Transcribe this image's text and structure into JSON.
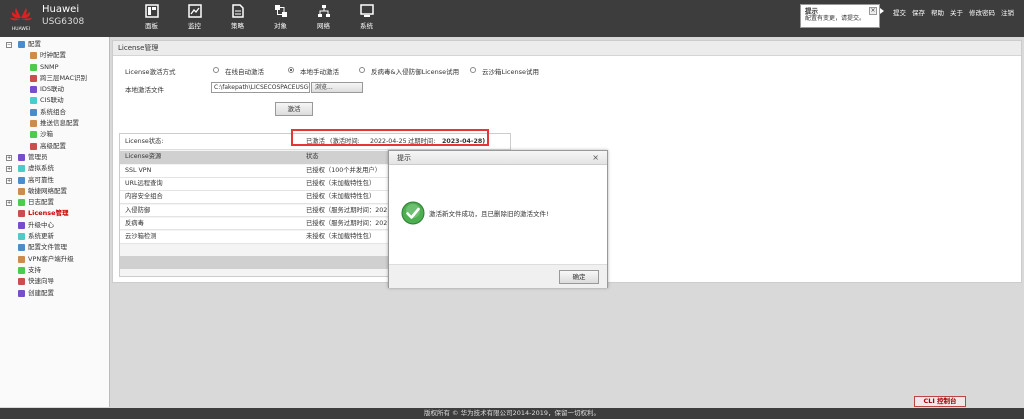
{
  "header": {
    "brand": "Huawei",
    "model": "USG6308",
    "logo_text": "HUAWEI",
    "nav": [
      {
        "label": "面板",
        "icon": "dashboard-icon"
      },
      {
        "label": "监控",
        "icon": "monitor-icon"
      },
      {
        "label": "策略",
        "icon": "policy-icon"
      },
      {
        "label": "对象",
        "icon": "object-icon"
      },
      {
        "label": "网络",
        "icon": "network-icon"
      },
      {
        "label": "系统",
        "icon": "system-icon"
      }
    ],
    "tip": {
      "title": "提示",
      "text": "配置有变更，请提交。",
      "close": "×"
    },
    "links": [
      "提交",
      "保存",
      "帮助",
      "关于",
      "修改密码",
      "注销"
    ]
  },
  "sidebar": {
    "items": [
      {
        "label": "配置",
        "level": 0,
        "expander": "−",
        "icon": "config-icon"
      },
      {
        "label": "时钟配置",
        "level": 1,
        "icon": "clock-icon"
      },
      {
        "label": "SNMP",
        "level": 1,
        "icon": "snmp-icon"
      },
      {
        "label": "跨三层MAC识别",
        "level": 1,
        "icon": "mac-icon"
      },
      {
        "label": "IDS联动",
        "level": 1,
        "icon": "ids-icon"
      },
      {
        "label": "CIS联动",
        "level": 1,
        "icon": "cis-icon"
      },
      {
        "label": "系统组合",
        "level": 1,
        "icon": "combo-icon"
      },
      {
        "label": "推送信息配置",
        "level": 1,
        "icon": "push-icon"
      },
      {
        "label": "沙箱",
        "level": 1,
        "icon": "sandbox-icon"
      },
      {
        "label": "高级配置",
        "level": 1,
        "icon": "advanced-icon"
      },
      {
        "label": "管理员",
        "level": 0,
        "expander": "+",
        "icon": "admin-icon"
      },
      {
        "label": "虚拟系统",
        "level": 0,
        "expander": "+",
        "icon": "vsys-icon"
      },
      {
        "label": "高可靠性",
        "level": 0,
        "expander": "+",
        "icon": "ha-icon"
      },
      {
        "label": "敏捷网络配置",
        "level": 0,
        "icon": "agile-icon"
      },
      {
        "label": "日志配置",
        "level": 0,
        "expander": "+",
        "icon": "log-icon"
      },
      {
        "label": "License管理",
        "level": 0,
        "icon": "license-icon",
        "active": true
      },
      {
        "label": "升级中心",
        "level": 0,
        "icon": "upgrade-icon"
      },
      {
        "label": "系统更新",
        "level": 0,
        "icon": "update-icon"
      },
      {
        "label": "配置文件管理",
        "level": 0,
        "icon": "file-icon"
      },
      {
        "label": "VPN客户端升级",
        "level": 0,
        "icon": "vpn-icon"
      },
      {
        "label": "支持",
        "level": 0,
        "icon": "support-icon"
      },
      {
        "label": "快速向导",
        "level": 0,
        "icon": "wizard-icon"
      },
      {
        "label": "创建配置",
        "level": 0,
        "icon": "create-icon"
      }
    ]
  },
  "main": {
    "title": "License管理",
    "mode_label": "License激活方式",
    "modes": [
      {
        "label": "在线自动激活",
        "selected": false
      },
      {
        "label": "本地手动激活",
        "selected": true
      },
      {
        "label": "反病毒&入侵防御License试用",
        "selected": false
      },
      {
        "label": "云沙箱License试用",
        "selected": false
      }
    ],
    "file_label": "本地激活文件",
    "file_value": "C:\\fakepath\\LICSECOSPACEUSG6300_V5",
    "browse_label": "浏览...",
    "activate_label": "激活",
    "status_label": "License状态:",
    "status_value": "已激活",
    "activated_label": "(激活时间:",
    "activated_date": "2022-04-25",
    "expire_label": "过期时间:",
    "expire_date": "2023-04-28)",
    "table": {
      "headers": [
        "License资源",
        "状态"
      ],
      "rows": [
        [
          "SSL VPN",
          "已授权（100个并发用户）"
        ],
        [
          "URL远程查询",
          "已授权（未加载特性包）"
        ],
        [
          "内容安全组合",
          "已授权（未加载特性包）"
        ],
        [
          "入侵防御",
          "已授权（服务过期时间：202"
        ],
        [
          "反病毒",
          "已授权（服务过期时间：202"
        ],
        [
          "云沙箱检测",
          "未授权（未加载特性包）"
        ]
      ]
    }
  },
  "dialog": {
    "title": "提示",
    "close": "×",
    "message": "激活新文件成功，且已删除旧的激活文件!",
    "ok_label": "确定"
  },
  "footer": {
    "cli_label": "CLI 控制台",
    "copyright": "版权所有 © 华为技术有限公司2014-2019，保留一切权利。"
  },
  "colors": {
    "header_bg": "#3d3d3d",
    "highlight_red": "#e53535",
    "active_item": "#cc0000",
    "success_green": "#4caf50"
  }
}
